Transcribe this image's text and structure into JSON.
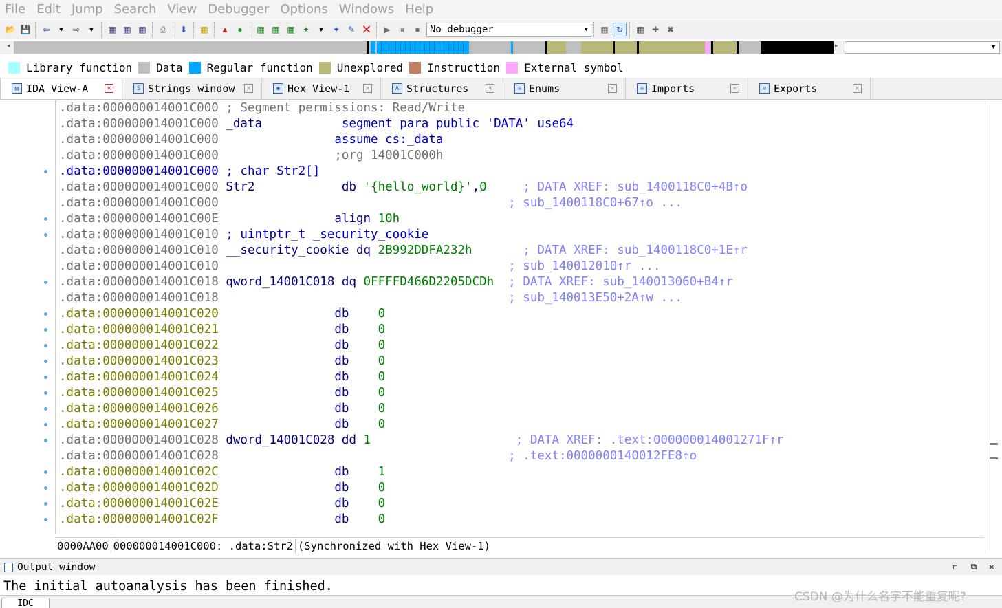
{
  "menu": [
    "File",
    "Edit",
    "Jump",
    "Search",
    "View",
    "Debugger",
    "Options",
    "Windows",
    "Help"
  ],
  "toolbar": {
    "debugger_select": "No debugger"
  },
  "legend": [
    {
      "label": "Library function",
      "color": "#a8ffff"
    },
    {
      "label": "Data",
      "color": "#c0c0c0"
    },
    {
      "label": "Regular function",
      "color": "#00a8ff"
    },
    {
      "label": "Unexplored",
      "color": "#b8b878"
    },
    {
      "label": "Instruction",
      "color": "#c08060"
    },
    {
      "label": "External symbol",
      "color": "#ffa8ff"
    }
  ],
  "tabs": [
    {
      "label": "IDA View-A",
      "active": true
    },
    {
      "label": "Strings window",
      "active": false
    },
    {
      "label": "Hex View-1",
      "active": false
    },
    {
      "label": "Structures",
      "active": false
    },
    {
      "label": "Enums",
      "active": false
    },
    {
      "label": "Imports",
      "active": false
    },
    {
      "label": "Exports",
      "active": false
    }
  ],
  "listing": [
    {
      "addr": ".data:000000014001C000",
      "addr_style": "grey",
      "parts": [
        {
          "t": " ; Segment permissions: Read/Write",
          "c": "cmt"
        }
      ],
      "dot": false
    },
    {
      "addr": ".data:000000014001C000",
      "addr_style": "grey",
      "parts": [
        {
          "t": " _data",
          "c": "plain"
        },
        {
          "t": "           segment para public 'DATA' use64",
          "c": "kw"
        }
      ],
      "dot": false
    },
    {
      "addr": ".data:000000014001C000",
      "addr_style": "grey",
      "parts": [
        {
          "t": "                assume cs:_data",
          "c": "kw"
        }
      ],
      "dot": false
    },
    {
      "addr": ".data:000000014001C000",
      "addr_style": "grey",
      "parts": [
        {
          "t": "                ;org 14001C000h",
          "c": "cmt"
        }
      ],
      "dot": false
    },
    {
      "addr": ".data:000000014001C000",
      "addr_style": "blue",
      "parts": [
        {
          "t": " ; char Str2[]",
          "c": "kw"
        }
      ],
      "dot": true
    },
    {
      "addr": ".data:000000014001C000",
      "addr_style": "grey",
      "parts": [
        {
          "t": " Str2",
          "c": "plain"
        },
        {
          "t": "            db ",
          "c": "plain"
        },
        {
          "t": "'{hello_world}'",
          "c": "str"
        },
        {
          "t": ",",
          "c": "plain"
        },
        {
          "t": "0",
          "c": "num"
        },
        {
          "t": "     ; DATA XREF: sub_1400118C0+4B↑o",
          "c": "xref"
        }
      ],
      "dot": false
    },
    {
      "addr": ".data:000000014001C000",
      "addr_style": "grey",
      "parts": [
        {
          "t": "                                        ; sub_1400118C0+67↑o ...",
          "c": "xref"
        }
      ],
      "dot": false
    },
    {
      "addr": ".data:000000014001C00E",
      "addr_style": "grey",
      "parts": [
        {
          "t": "                align ",
          "c": "plain"
        },
        {
          "t": "10h",
          "c": "num"
        }
      ],
      "dot": true
    },
    {
      "addr": ".data:000000014001C010",
      "addr_style": "grey",
      "parts": [
        {
          "t": " ; uintptr_t _security_cookie",
          "c": "kw"
        }
      ],
      "dot": true
    },
    {
      "addr": ".data:000000014001C010",
      "addr_style": "grey",
      "parts": [
        {
          "t": " __security_cookie dq ",
          "c": "plain"
        },
        {
          "t": "2B992DDFA232h",
          "c": "num"
        },
        {
          "t": "       ; DATA XREF: sub_1400118C0+1E↑r",
          "c": "xref"
        }
      ],
      "dot": false
    },
    {
      "addr": ".data:000000014001C010",
      "addr_style": "grey",
      "parts": [
        {
          "t": "                                        ; sub_140012010↑r ...",
          "c": "xref"
        }
      ],
      "dot": false
    },
    {
      "addr": ".data:000000014001C018",
      "addr_style": "grey",
      "parts": [
        {
          "t": " qword_14001C018 dq ",
          "c": "plain"
        },
        {
          "t": "0FFFFD466D2205DCDh",
          "c": "num"
        },
        {
          "t": "  ; DATA XREF: sub_140013060+B4↑r",
          "c": "xref"
        }
      ],
      "dot": true
    },
    {
      "addr": ".data:000000014001C018",
      "addr_style": "grey",
      "parts": [
        {
          "t": "                                        ; sub_140013E50+2A↑w ...",
          "c": "xref"
        }
      ],
      "dot": false
    },
    {
      "addr": ".data:000000014001C020",
      "addr_style": "yellow",
      "parts": [
        {
          "t": "                db    ",
          "c": "plain"
        },
        {
          "t": "0",
          "c": "num"
        }
      ],
      "dot": true
    },
    {
      "addr": ".data:000000014001C021",
      "addr_style": "yellow",
      "parts": [
        {
          "t": "                db    ",
          "c": "plain"
        },
        {
          "t": "0",
          "c": "num"
        }
      ],
      "dot": true
    },
    {
      "addr": ".data:000000014001C022",
      "addr_style": "yellow",
      "parts": [
        {
          "t": "                db    ",
          "c": "plain"
        },
        {
          "t": "0",
          "c": "num"
        }
      ],
      "dot": true
    },
    {
      "addr": ".data:000000014001C023",
      "addr_style": "yellow",
      "parts": [
        {
          "t": "                db    ",
          "c": "plain"
        },
        {
          "t": "0",
          "c": "num"
        }
      ],
      "dot": true
    },
    {
      "addr": ".data:000000014001C024",
      "addr_style": "yellow",
      "parts": [
        {
          "t": "                db    ",
          "c": "plain"
        },
        {
          "t": "0",
          "c": "num"
        }
      ],
      "dot": true
    },
    {
      "addr": ".data:000000014001C025",
      "addr_style": "yellow",
      "parts": [
        {
          "t": "                db    ",
          "c": "plain"
        },
        {
          "t": "0",
          "c": "num"
        }
      ],
      "dot": true
    },
    {
      "addr": ".data:000000014001C026",
      "addr_style": "yellow",
      "parts": [
        {
          "t": "                db    ",
          "c": "plain"
        },
        {
          "t": "0",
          "c": "num"
        }
      ],
      "dot": true
    },
    {
      "addr": ".data:000000014001C027",
      "addr_style": "yellow",
      "parts": [
        {
          "t": "                db    ",
          "c": "plain"
        },
        {
          "t": "0",
          "c": "num"
        }
      ],
      "dot": true
    },
    {
      "addr": ".data:000000014001C028",
      "addr_style": "grey",
      "parts": [
        {
          "t": " dword_14001C028 dd ",
          "c": "plain"
        },
        {
          "t": "1",
          "c": "num"
        },
        {
          "t": "                    ; DATA XREF: .text:000000014001271F↑r",
          "c": "xref"
        }
      ],
      "dot": true
    },
    {
      "addr": ".data:000000014001C028",
      "addr_style": "grey",
      "parts": [
        {
          "t": "                                        ; .text:0000000140012FE8↑o",
          "c": "xref"
        }
      ],
      "dot": false
    },
    {
      "addr": ".data:000000014001C02C",
      "addr_style": "yellow",
      "parts": [
        {
          "t": "                db    ",
          "c": "plain"
        },
        {
          "t": "1",
          "c": "num"
        }
      ],
      "dot": true
    },
    {
      "addr": ".data:000000014001C02D",
      "addr_style": "yellow",
      "parts": [
        {
          "t": "                db    ",
          "c": "plain"
        },
        {
          "t": "0",
          "c": "num"
        }
      ],
      "dot": true
    },
    {
      "addr": ".data:000000014001C02E",
      "addr_style": "yellow",
      "parts": [
        {
          "t": "                db    ",
          "c": "plain"
        },
        {
          "t": "0",
          "c": "num"
        }
      ],
      "dot": true
    },
    {
      "addr": ".data:000000014001C02F",
      "addr_style": "yellow",
      "parts": [
        {
          "t": "                db    ",
          "c": "plain"
        },
        {
          "t": "0",
          "c": "num"
        }
      ],
      "dot": true
    }
  ],
  "status": {
    "offset": "0000AA00",
    "location": "000000014001C000: .data:Str2",
    "sync": "(Synchronized with Hex View-1)"
  },
  "output": {
    "title": "Output window",
    "message": "The initial autoanalysis has been finished.",
    "idc_tab": "IDC"
  },
  "watermark": "CSDN @为什么名字不能重复呢?"
}
